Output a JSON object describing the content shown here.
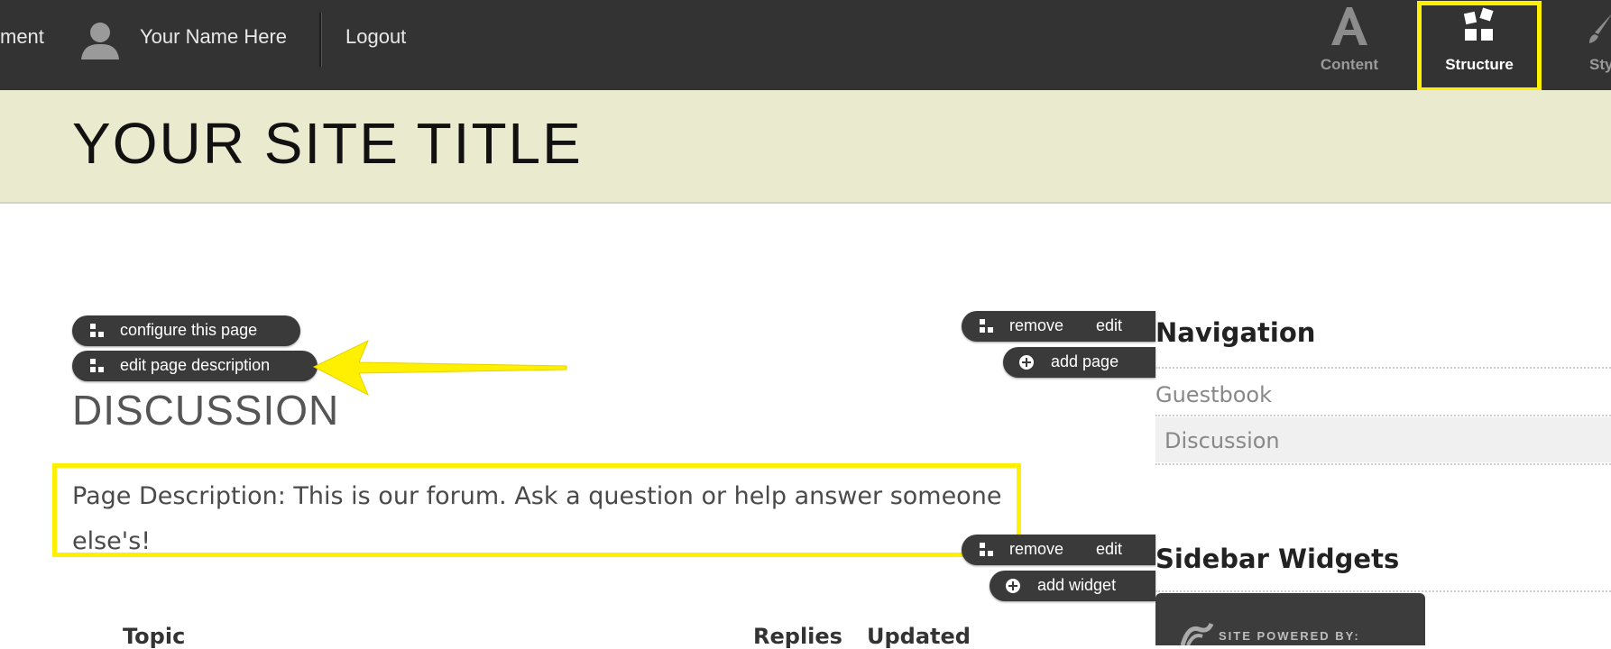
{
  "admin_bar": {
    "left_truncated": "ment",
    "user_name": "Your Name Here",
    "logout": "Logout",
    "tabs": [
      {
        "label": "Content",
        "icon": "letter-a-icon",
        "active": false
      },
      {
        "label": "Structure",
        "icon": "blocks-icon",
        "active": true
      },
      {
        "label": "Sty",
        "icon": "brush-icon",
        "active": false
      }
    ],
    "highlight_color": "#ffef00"
  },
  "header": {
    "site_title": "YOUR SITE TITLE",
    "background": "#eaeacf"
  },
  "main": {
    "configure_label": "configure this page",
    "edit_description_label": "edit page description",
    "page_title": "DISCUSSION",
    "description": "Page Description: This is our forum. Ask a question or help answer someone else's!",
    "table_headers": [
      "Topic",
      "Replies",
      "Updated"
    ]
  },
  "sidebar": {
    "navigation": {
      "remove_label": "remove",
      "edit_label": "edit",
      "add_label": "add page",
      "title": "Navigation",
      "items": [
        "Guestbook",
        "Discussion"
      ],
      "current_item": "Discussion"
    },
    "widgets": {
      "remove_label": "remove",
      "edit_label": "edit",
      "add_label": "add widget",
      "title": "Sidebar Widgets",
      "widget_text": "SITE POWERED BY:"
    }
  }
}
